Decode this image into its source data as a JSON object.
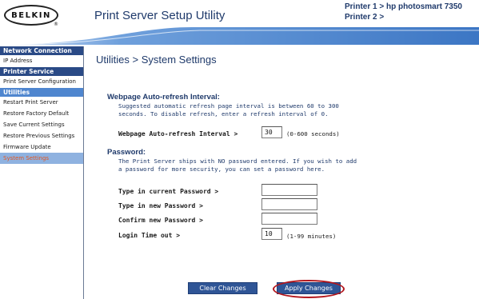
{
  "header": {
    "brand": "BELKIN",
    "brand_mark": "®",
    "app_title": "Print Server Setup Utility",
    "printer_1": "Printer 1 > hp photosmart 7350",
    "printer_2": "Printer 2 >"
  },
  "sidebar": {
    "network_heading": "Network Connection",
    "network_items": [
      "IP Address"
    ],
    "printer_heading": "Printer Service",
    "printer_items": [
      "Print Server Configuration"
    ],
    "utilities_heading": "Utilities",
    "utility_items": [
      "Restart Print Server",
      "Restore Factory Default",
      "Save Current Settings",
      "Restore Previous Settings",
      "Firmware Update",
      "System Settings"
    ],
    "active_item": "System Settings"
  },
  "main": {
    "page_title": "Utilities > System Settings",
    "refresh": {
      "heading": "Webpage Auto-refresh Interval:",
      "description_line1": "Suggested automatic refresh page interval is between 60 to 300",
      "description_line2": "seconds. To disable refresh, enter a refresh interval of 0.",
      "label": "Webpage Auto-refresh Interval >",
      "value": "30",
      "hint": "(0-600 seconds)"
    },
    "password": {
      "heading": "Password:",
      "description_line1": "The Print Server ships with NO password entered. If you wish to add",
      "description_line2": "a password for more security, you can set a password here.",
      "current_label": "Type in current Password >",
      "new_label": "Type in new Password >",
      "confirm_label": "Confirm new Password >",
      "timeout_label": "Login Time out >",
      "timeout_value": "10",
      "timeout_hint": "(1-99 minutes)"
    },
    "buttons": {
      "clear": "Clear Changes",
      "apply": "Apply Changes"
    }
  },
  "colors": {
    "navy": "#1f3a6b",
    "sidebar_heading": "#2a4a86",
    "utilities_heading": "#4f86cf",
    "active_item_bg": "#8fb2e0",
    "active_item_text": "#e4561f",
    "button": "#2f5596",
    "highlight_ring": "#b3171d"
  }
}
